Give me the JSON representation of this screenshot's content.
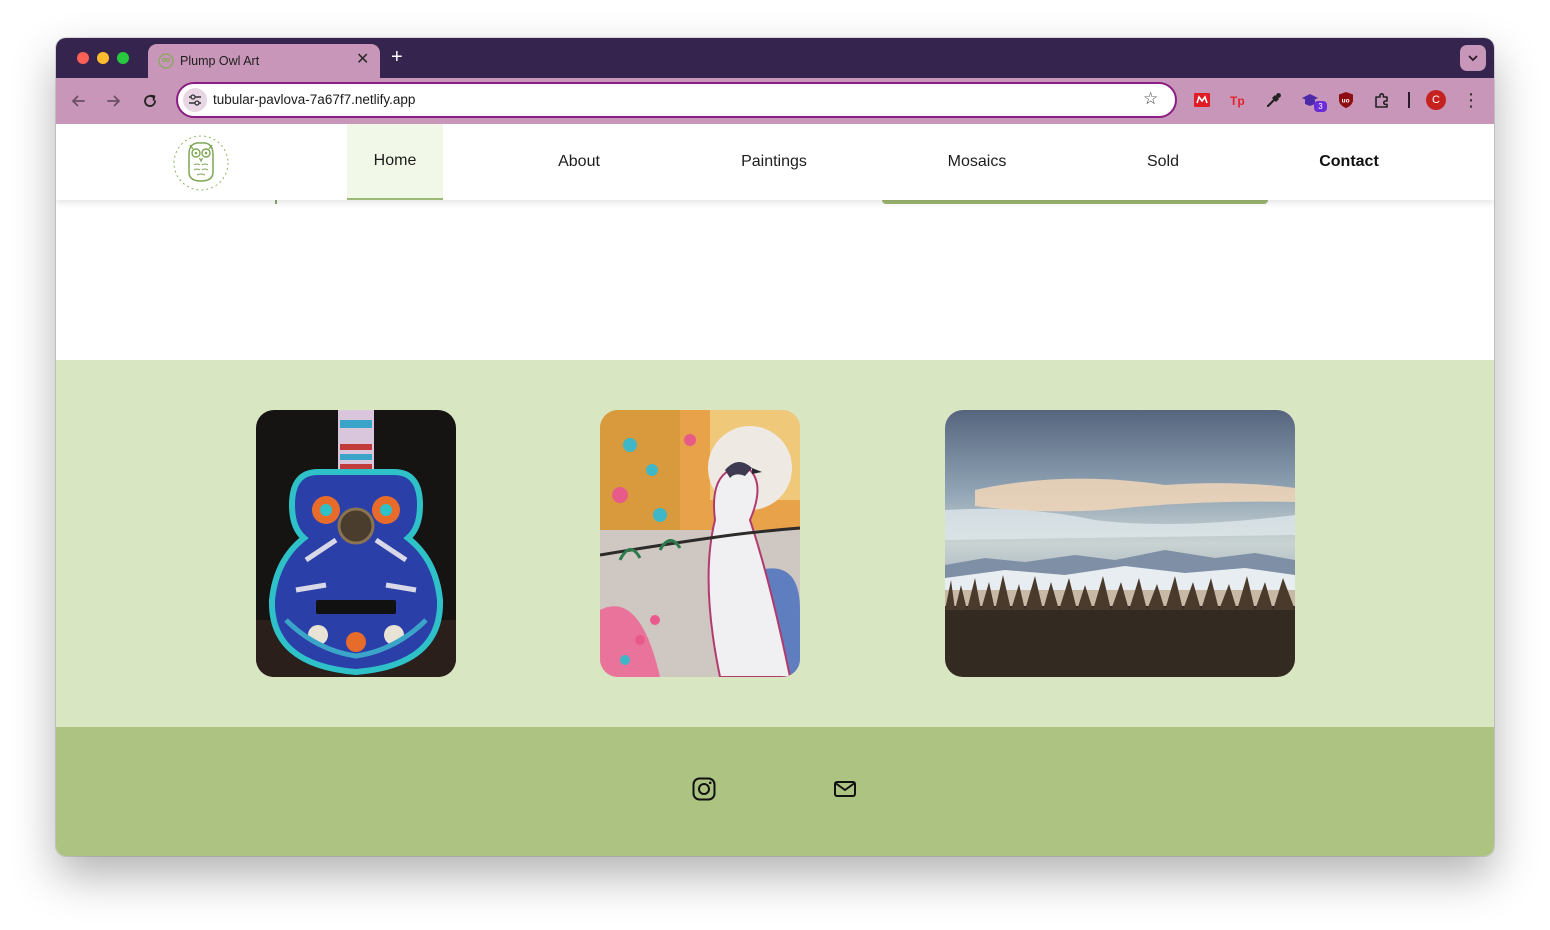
{
  "browser": {
    "tab": {
      "title": "Plump Owl Art"
    },
    "address_bar": {
      "url": "tubular-pavlova-7a67f7.netlify.app"
    },
    "extension_badge": "3",
    "profile_initial": "C"
  },
  "site": {
    "nav": [
      {
        "label": "Home",
        "active": true
      },
      {
        "label": "About"
      },
      {
        "label": "Paintings"
      },
      {
        "label": "Mosaics"
      },
      {
        "label": "Sold"
      },
      {
        "label": "Contact",
        "emphasis": "bold"
      }
    ],
    "gallery": [
      {
        "subject": "mosaic-guitar"
      },
      {
        "subject": "bird-painting"
      },
      {
        "subject": "winter-landscape-photo"
      }
    ],
    "footer_links": [
      "instagram",
      "email"
    ]
  },
  "colors": {
    "tab_strip": "#35244e",
    "toolbar": "#c896b8",
    "omnibox_border": "#8a1d84",
    "nav_active_bg": "#f2f8e8",
    "accent_green": "#9db873",
    "gallery_bg": "#d9e6c2",
    "footer_bg": "#acc381"
  }
}
